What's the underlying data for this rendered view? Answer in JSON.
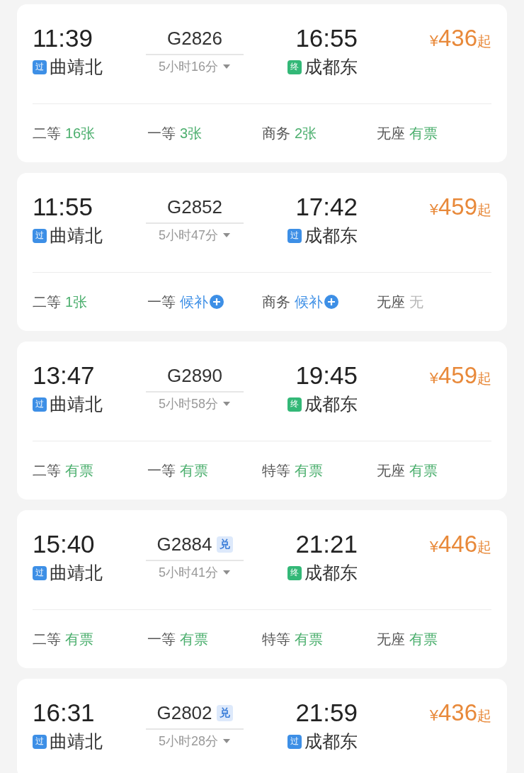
{
  "trains": [
    {
      "depart_time": "11:39",
      "from": {
        "badge": "过",
        "kind": "pass",
        "name": "曲靖北"
      },
      "train_no": "G2826",
      "duration": "5小时16分",
      "arrive_time": "16:55",
      "to": {
        "badge": "终",
        "kind": "terminal",
        "name": "成都东"
      },
      "currency": "¥",
      "price": "436",
      "price_suffix": "起",
      "seats": [
        {
          "label": "二等",
          "status": "16张",
          "kind": "available"
        },
        {
          "label": "一等",
          "status": "3张",
          "kind": "available"
        },
        {
          "label": "商务",
          "status": "2张",
          "kind": "available"
        },
        {
          "label": "无座",
          "status": "有票",
          "kind": "available"
        }
      ]
    },
    {
      "depart_time": "11:55",
      "from": {
        "badge": "过",
        "kind": "pass",
        "name": "曲靖北"
      },
      "train_no": "G2852",
      "duration": "5小时47分",
      "arrive_time": "17:42",
      "to": {
        "badge": "过",
        "kind": "pass",
        "name": "成都东"
      },
      "currency": "¥",
      "price": "459",
      "price_suffix": "起",
      "seats": [
        {
          "label": "二等",
          "status": "1张",
          "kind": "available"
        },
        {
          "label": "一等",
          "status": "候补",
          "kind": "waitlist"
        },
        {
          "label": "商务",
          "status": "候补",
          "kind": "waitlist"
        },
        {
          "label": "无座",
          "status": "无",
          "kind": "none"
        }
      ]
    },
    {
      "depart_time": "13:47",
      "from": {
        "badge": "过",
        "kind": "pass",
        "name": "曲靖北"
      },
      "train_no": "G2890",
      "duration": "5小时58分",
      "arrive_time": "19:45",
      "to": {
        "badge": "终",
        "kind": "terminal",
        "name": "成都东"
      },
      "currency": "¥",
      "price": "459",
      "price_suffix": "起",
      "seats": [
        {
          "label": "二等",
          "status": "有票",
          "kind": "available"
        },
        {
          "label": "一等",
          "status": "有票",
          "kind": "available"
        },
        {
          "label": "特等",
          "status": "有票",
          "kind": "available"
        },
        {
          "label": "无座",
          "status": "有票",
          "kind": "available"
        }
      ]
    },
    {
      "depart_time": "15:40",
      "from": {
        "badge": "过",
        "kind": "pass",
        "name": "曲靖北"
      },
      "train_no": "G2884",
      "redeem": "兑",
      "duration": "5小时41分",
      "arrive_time": "21:21",
      "to": {
        "badge": "终",
        "kind": "terminal",
        "name": "成都东"
      },
      "currency": "¥",
      "price": "446",
      "price_suffix": "起",
      "seats": [
        {
          "label": "二等",
          "status": "有票",
          "kind": "available"
        },
        {
          "label": "一等",
          "status": "有票",
          "kind": "available"
        },
        {
          "label": "特等",
          "status": "有票",
          "kind": "available"
        },
        {
          "label": "无座",
          "status": "有票",
          "kind": "available"
        }
      ]
    },
    {
      "depart_time": "16:31",
      "from": {
        "badge": "过",
        "kind": "pass",
        "name": "曲靖北"
      },
      "train_no": "G2802",
      "redeem": "兑",
      "duration": "5小时28分",
      "arrive_time": "21:59",
      "to": {
        "badge": "过",
        "kind": "pass",
        "name": "成都东"
      },
      "currency": "¥",
      "price": "436",
      "price_suffix": "起"
    }
  ]
}
